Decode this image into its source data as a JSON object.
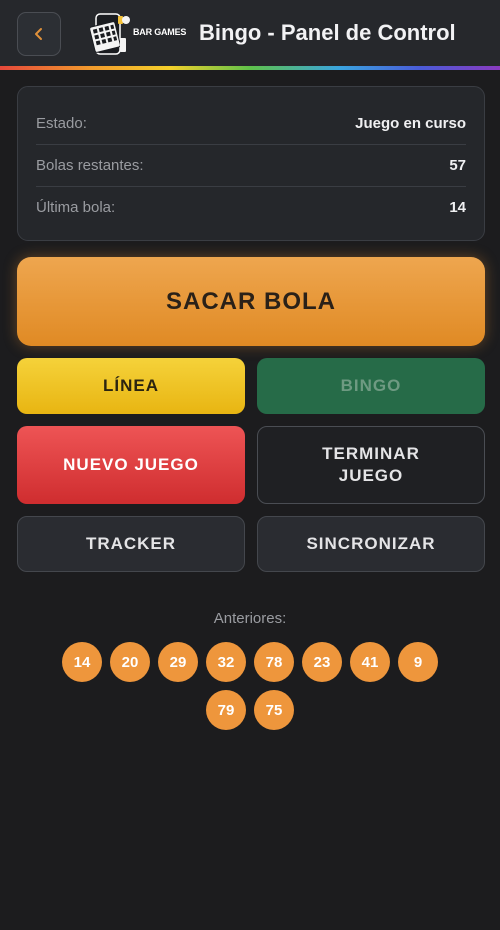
{
  "header": {
    "title": "Bingo - Panel de Control",
    "logo_text": "BAR GAMES",
    "back_icon": "chevron-left-icon",
    "accent_color": "#e0913a"
  },
  "status": {
    "rows": [
      {
        "label": "Estado:",
        "value": "Juego en curso"
      },
      {
        "label": "Bolas restantes:",
        "value": "57"
      },
      {
        "label": "Última bola:",
        "value": "14"
      }
    ]
  },
  "actions": {
    "draw_ball": "SACAR BOLA",
    "line": "LÍNEA",
    "bingo": "BINGO",
    "new_game": "NUEVO JUEGO",
    "end_game": "TERMINAR JUEGO",
    "tracker": "TRACKER",
    "sync": "SINCRONIZAR"
  },
  "previous": {
    "label": "Anteriores:",
    "balls": [
      "14",
      "20",
      "29",
      "32",
      "78",
      "23",
      "41",
      "9",
      "79",
      "75"
    ],
    "ball_color": "#ee963c"
  }
}
